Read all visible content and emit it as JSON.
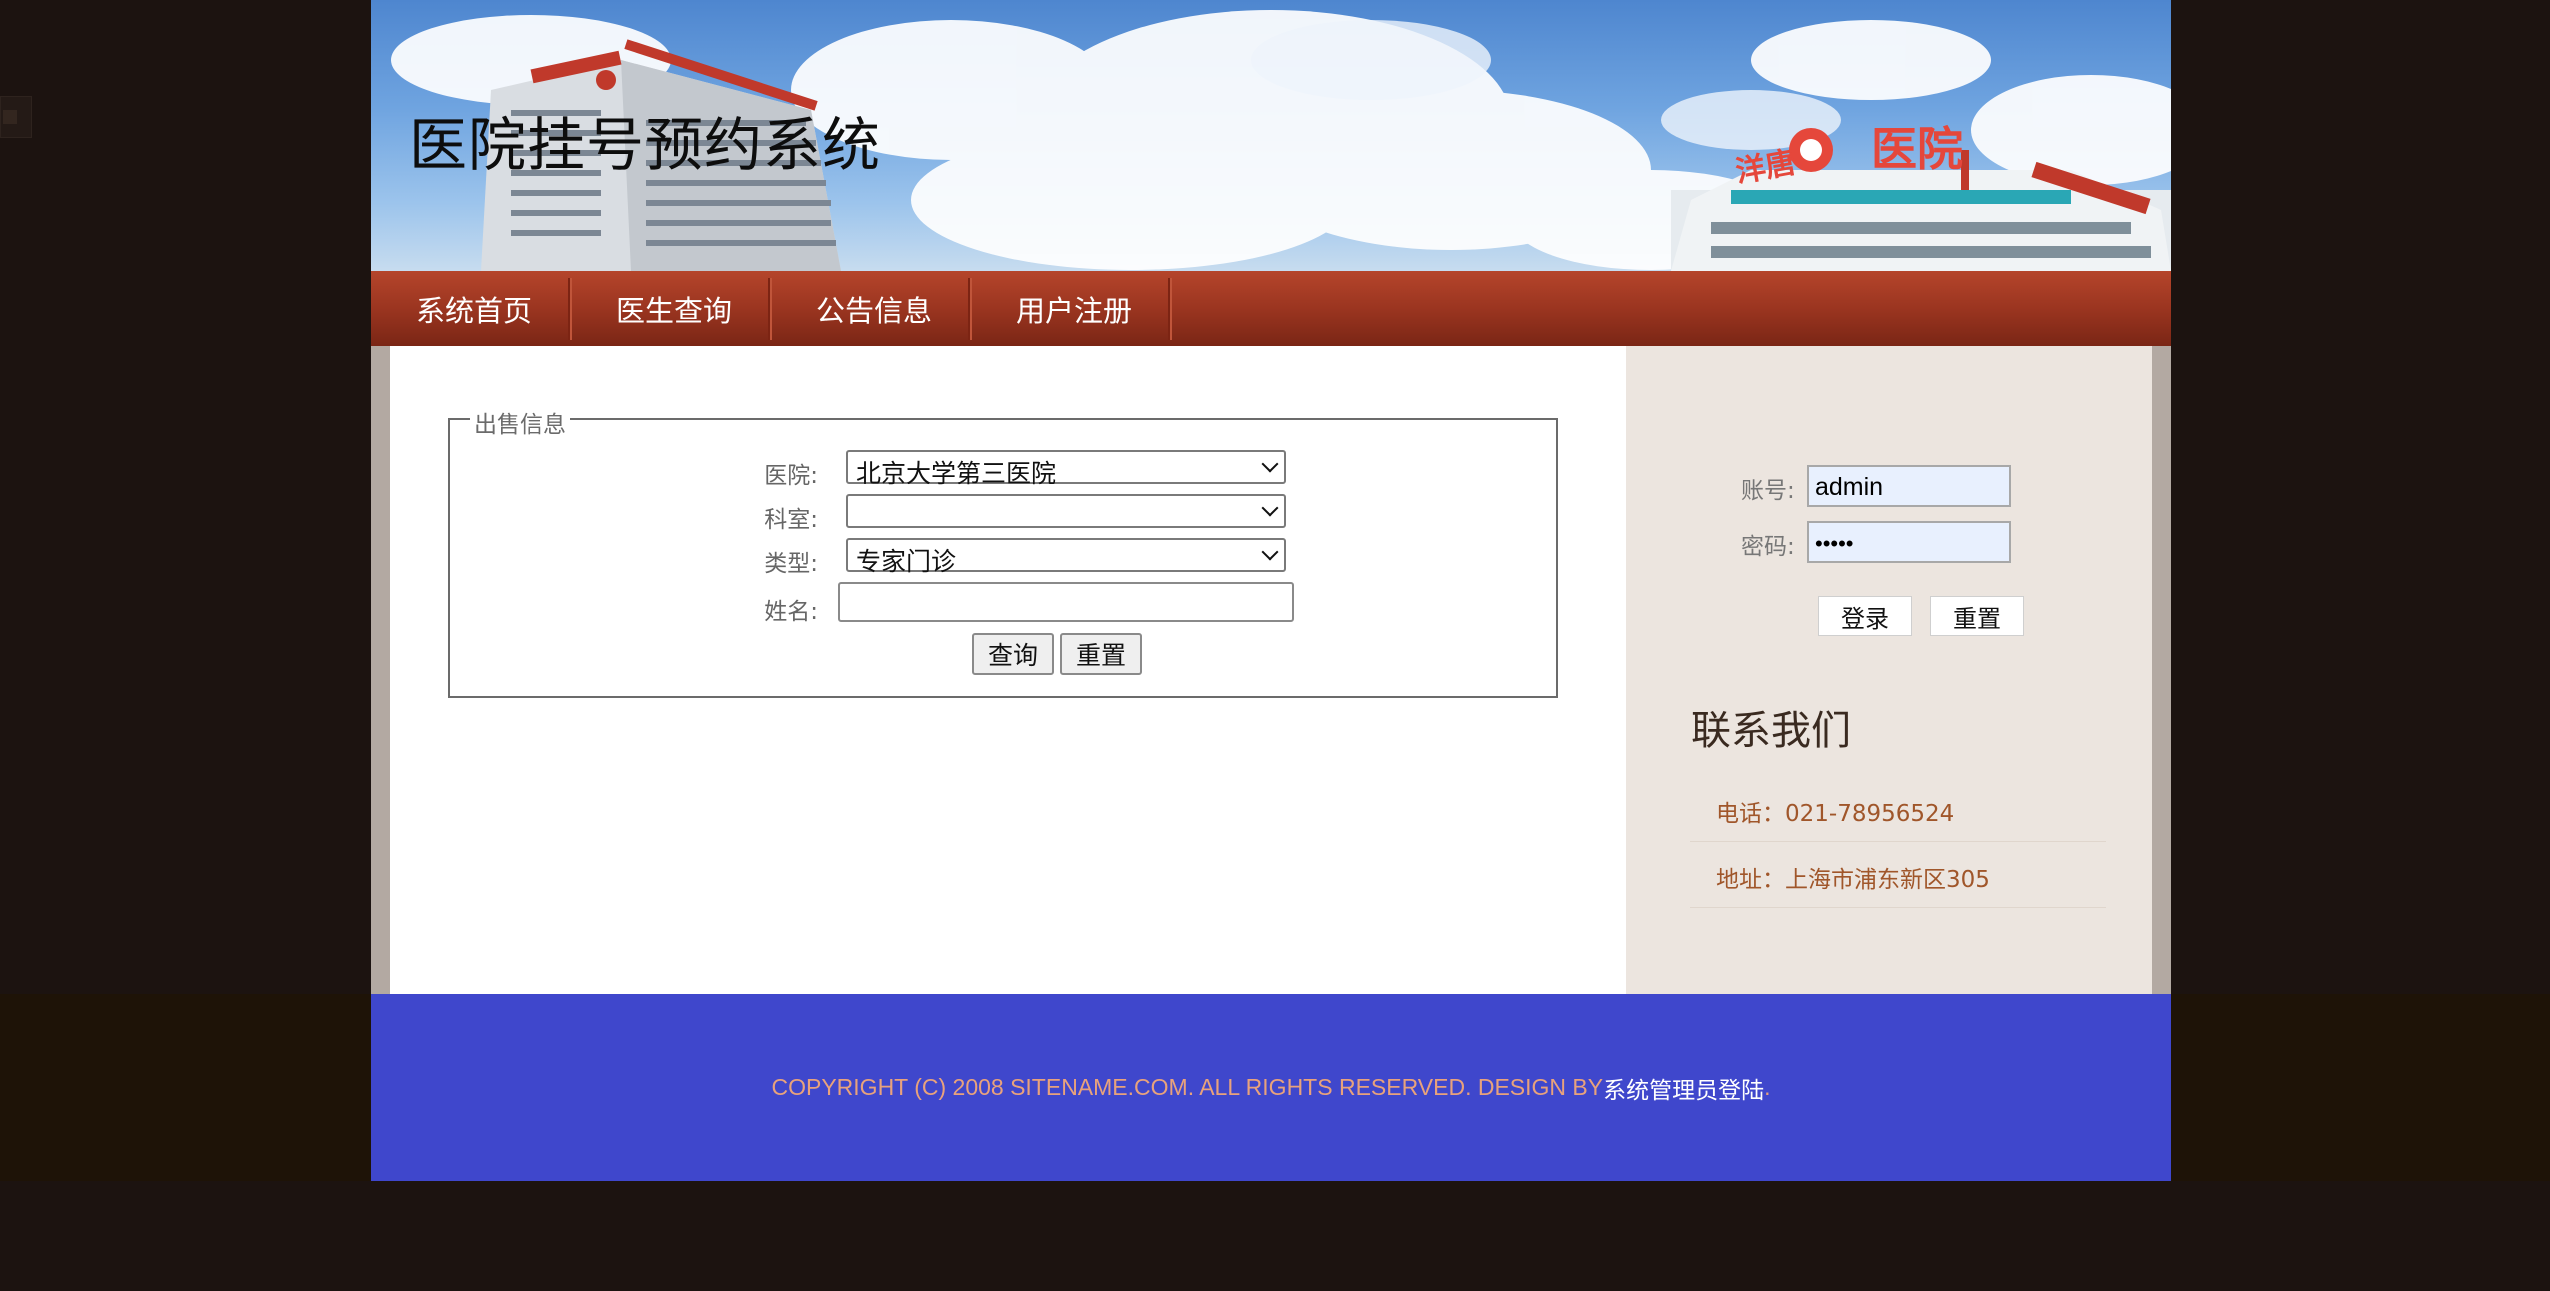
{
  "header": {
    "title": "医院挂号预约系统"
  },
  "nav": {
    "items": [
      "系统首页",
      "医生查询",
      "公告信息",
      "用户注册"
    ]
  },
  "search_panel": {
    "legend": "出售信息",
    "hospital_label": "医院:",
    "hospital_value": "北京大学第三医院",
    "department_label": "科室:",
    "department_value": "",
    "type_label": "类型:",
    "type_value": "专家门诊",
    "name_label": "姓名:",
    "name_value": "",
    "search_button": "查询",
    "reset_button": "重置"
  },
  "login": {
    "account_label": "账号:",
    "account_value": "admin",
    "password_label": "密码:",
    "password_value": "•••••",
    "login_button": "登录",
    "reset_button": "重置"
  },
  "contact": {
    "title": "联系我们",
    "phone": "电话：021-78956524",
    "address": "地址：上海市浦东新区305"
  },
  "footer": {
    "copyright": "COPYRIGHT (C) 2008 SITENAME.COM. ALL RIGHTS RESERVED. DESIGN BY ",
    "admin_link": "系统管理员登陆",
    "period": "."
  },
  "colors": {
    "nav_bar": "#9b3520",
    "footer_bg": "#3f47cc",
    "footer_text": "#e8a27c",
    "contact_text": "#a0562a",
    "sidebar_bg": "#ece5df",
    "autofill_bg": "#e8f0fe"
  },
  "icons": {
    "dropdown": "chevron-down-icon",
    "banner": "hospital-building-image"
  }
}
